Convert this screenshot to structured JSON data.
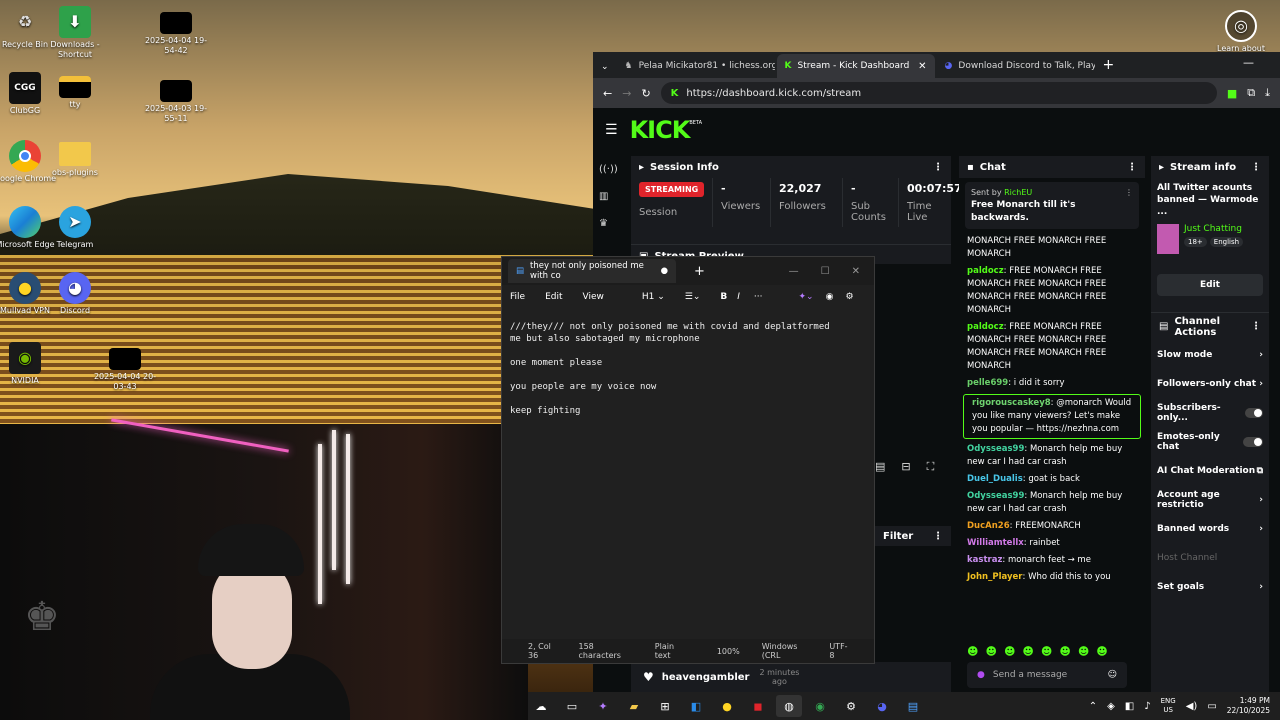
{
  "desktop": {
    "icons": [
      {
        "label": "Recycle Bin"
      },
      {
        "label": "Downloads - Shortcut"
      },
      {
        "label": "2025-04-04 19-54-42"
      },
      {
        "label": "ClubGG"
      },
      {
        "label": "tty"
      },
      {
        "label": "2025-04-03 19-55-11"
      },
      {
        "label": "Google Chrome"
      },
      {
        "label": "obs-plugins"
      },
      {
        "label": "Microsoft Edge"
      },
      {
        "label": "Telegram"
      },
      {
        "label": "Mullvad VPN"
      },
      {
        "label": "Discord"
      },
      {
        "label": "NVIDIA"
      },
      {
        "label": "2025-04-04 20-03-43"
      }
    ],
    "learn_label": "Learn about"
  },
  "browser": {
    "tabs": [
      {
        "title": "Pelaa Micikator81 • lichess.org"
      },
      {
        "title": "Stream - Kick Dashboard"
      },
      {
        "title": "Download Discord to Talk, Play"
      }
    ],
    "url": "https://dashboard.kick.com/stream"
  },
  "kick": {
    "logo": "KICK",
    "beta": "BETA",
    "session": {
      "title": "Session Info",
      "badge": "STREAMING",
      "badge_sub": "Session",
      "viewers_value": "-",
      "viewers_label": "Viewers",
      "followers_value": "22,027",
      "followers_label": "Followers",
      "subs_value": "-",
      "subs_label": "Sub Counts",
      "time_value": "00:07:57",
      "time_label": "Time Live"
    },
    "preview_title": "Stream Preview",
    "filter_label": "Filter",
    "activity": {
      "user": "heavengambler",
      "time": "2 minutes ago"
    },
    "chat": {
      "title": "Chat",
      "pinned_by": "Sent by",
      "pinned_user": "RichEU",
      "pinned_text": "Free Monarch till it's backwards.",
      "messages": [
        {
          "user": "",
          "text": "MONARCH FREE MONARCH FREE MONARCH",
          "color": "#ffffff"
        },
        {
          "user": "paldocz",
          "text": "FREE MONARCH FREE MONARCH FREE MONARCH FREE MONARCH FREE MONARCH FREE MONARCH",
          "color": "#53fc18"
        },
        {
          "user": "paldocz",
          "text": "FREE MONARCH FREE MONARCH FREE MONARCH FREE MONARCH FREE MONARCH FREE MONARCH",
          "color": "#53fc18"
        },
        {
          "user": "pelle699",
          "text": "i did it sorry",
          "color": "#6ad06a"
        },
        {
          "user": "rigorouscaskey8",
          "text": "@monarch Would you like many viewers? Let's make you popular — https://nezhna.com",
          "color": "#6fd36f"
        },
        {
          "user": "Odysseas99",
          "text": "Monarch help me buy new car I had car crash",
          "color": "#42d3a0"
        },
        {
          "user": "Duel_Dualis",
          "text": "goat is back",
          "color": "#48c6e8"
        },
        {
          "user": "Odysseas99",
          "text": "Monarch help me buy new car I had car crash",
          "color": "#42d3a0"
        },
        {
          "user": "DucAn26",
          "text": "FREEMONARCH",
          "color": "#f0a020"
        },
        {
          "user": "Williamtellx",
          "text": "rainbet",
          "color": "#d27ae8"
        },
        {
          "user": "kastraz",
          "text": "monarch feet → me",
          "color": "#c98ff0"
        },
        {
          "user": "John_Player",
          "text": "Who did this to you",
          "color": "#f0c020"
        }
      ],
      "input_placeholder": "Send a message"
    },
    "stream_info": {
      "title": "Stream info",
      "stream_title": "All Twitter acounts banned — Warmode ...",
      "category": "Just Chatting",
      "tag1": "18+",
      "tag2": "English",
      "edit_label": "Edit"
    },
    "channel_actions": {
      "title": "Channel Actions",
      "items": [
        {
          "label": "Slow mode"
        },
        {
          "label": "Followers-only chat"
        },
        {
          "label": "Subscribers-only..."
        },
        {
          "label": "Emotes-only chat"
        },
        {
          "label": "AI Chat Moderation"
        },
        {
          "label": "Account age restrictio"
        },
        {
          "label": "Banned words"
        },
        {
          "label": "Host Channel"
        },
        {
          "label": "Set goals"
        }
      ]
    }
  },
  "notepad": {
    "tab_title": "they not only poisoned me with co",
    "menu": [
      "File",
      "Edit",
      "View"
    ],
    "heading": "H1",
    "content": "///they/// not only poisoned me with covid and deplatformed\nme but also sabotaged my microphone\n\none moment please\n\nyou people are my voice now\n\nkeep fighting",
    "status": {
      "position": "2, Col 36",
      "chars": "158 characters",
      "format": "Plain text",
      "zoom": "100%",
      "eol": "Windows (CRL",
      "encoding": "UTF-8"
    }
  },
  "taskbar": {
    "lang": "ENG",
    "region": "US",
    "time": "1:49 PM",
    "date": "22/10/2025"
  }
}
